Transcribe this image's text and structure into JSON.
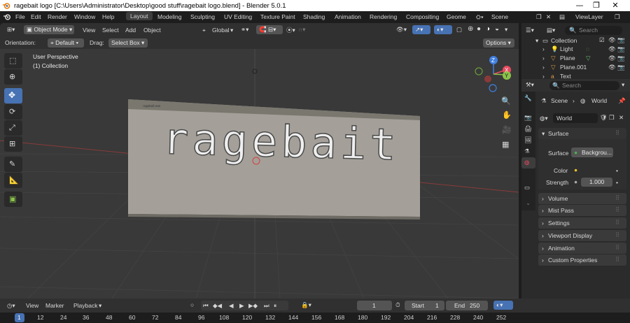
{
  "window": {
    "title": "ragebait logo [C:\\Users\\Administrator\\Desktop\\good stuff\\ragebait logo.blend] - Blender 5.0.1"
  },
  "menu": {
    "items": [
      "File",
      "Edit",
      "Render",
      "Window",
      "Help"
    ]
  },
  "workspaces": [
    "Layout",
    "Modeling",
    "Sculpting",
    "UV Editing",
    "Texture Paint",
    "Shading",
    "Animation",
    "Rendering",
    "Compositing",
    "Geome"
  ],
  "scene": {
    "label": "Scene"
  },
  "view_layer": {
    "label": "ViewLayer"
  },
  "viewport_header": {
    "mode": "Object Mode",
    "menus": [
      "View",
      "Select",
      "Add",
      "Object"
    ],
    "transform_orientation": "Global",
    "orientation_label": "Orientation:",
    "orientation_value": "Default",
    "drag_label": "Drag:",
    "drag_value": "Select Box",
    "options_label": "Options"
  },
  "viewport": {
    "perspective": "User Perspective",
    "collection": "(1) Collection",
    "logo_text": "ragebait",
    "screen_small_text": "ragebait.exe"
  },
  "outliner": {
    "search_placeholder": "Search",
    "collection": "Collection",
    "items": [
      "Light",
      "Plane",
      "Plane.001",
      "Text"
    ]
  },
  "properties": {
    "search_placeholder": "Search",
    "breadcrumb_scene": "Scene",
    "breadcrumb_world": "World",
    "world_name": "World",
    "surface_panel": "Surface",
    "surface_label": "Surface",
    "surface_value": "Backgrou...",
    "color_label": "Color",
    "strength_label": "Strength",
    "strength_value": "1.000",
    "panels": [
      "Volume",
      "Mist Pass",
      "Settings",
      "Viewport Display",
      "Animation",
      "Custom Properties"
    ]
  },
  "timeline": {
    "menus": [
      "View",
      "Marker",
      "Playback"
    ],
    "current_frame": "1",
    "start_label": "Start",
    "start_value": "1",
    "end_label": "End",
    "end_value": "250",
    "ruler": [
      "1",
      "12",
      "24",
      "36",
      "48",
      "60",
      "72",
      "84",
      "96",
      "108",
      "120",
      "132",
      "144",
      "156",
      "168",
      "180",
      "192",
      "204",
      "216",
      "228",
      "240",
      "252"
    ]
  },
  "colors": {
    "accent": "#4772b3",
    "axis_x": "#e84a5f",
    "axis_y": "#8bc34a",
    "axis_z": "#3f7fe0"
  }
}
